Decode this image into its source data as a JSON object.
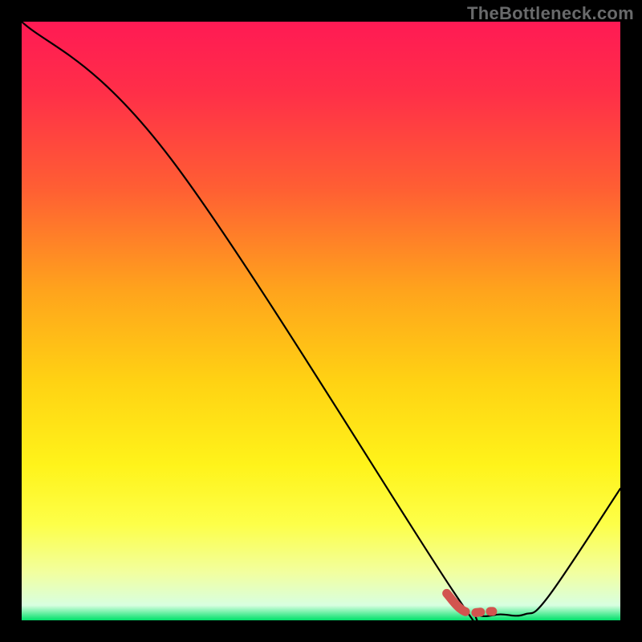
{
  "watermark": "TheBottleneck.com",
  "chart_data": {
    "type": "line",
    "title": "",
    "xlabel": "",
    "ylabel": "",
    "xlim": [
      0,
      100
    ],
    "ylim": [
      0,
      100
    ],
    "curve": {
      "x": [
        0,
        25,
        72,
        76,
        80,
        84,
        88,
        100
      ],
      "y": [
        100,
        77,
        5,
        1,
        1,
        1,
        4,
        22
      ]
    },
    "highlight_segment": {
      "x": [
        71,
        74,
        78,
        81,
        82.5,
        84,
        85.5
      ],
      "y": [
        4.5,
        1.5,
        1.5,
        1.5,
        2,
        2,
        2.8
      ]
    },
    "highlight_color": "#d2544f",
    "gradient_stops": [
      {
        "offset": 0.0,
        "color": "#ff1a54"
      },
      {
        "offset": 0.12,
        "color": "#ff2f48"
      },
      {
        "offset": 0.28,
        "color": "#ff5f33"
      },
      {
        "offset": 0.45,
        "color": "#ffa41c"
      },
      {
        "offset": 0.6,
        "color": "#ffd213"
      },
      {
        "offset": 0.74,
        "color": "#fff31a"
      },
      {
        "offset": 0.84,
        "color": "#fdff49"
      },
      {
        "offset": 0.92,
        "color": "#f2ff9f"
      },
      {
        "offset": 0.975,
        "color": "#d8ffe0"
      },
      {
        "offset": 1.0,
        "color": "#00e06a"
      }
    ]
  }
}
